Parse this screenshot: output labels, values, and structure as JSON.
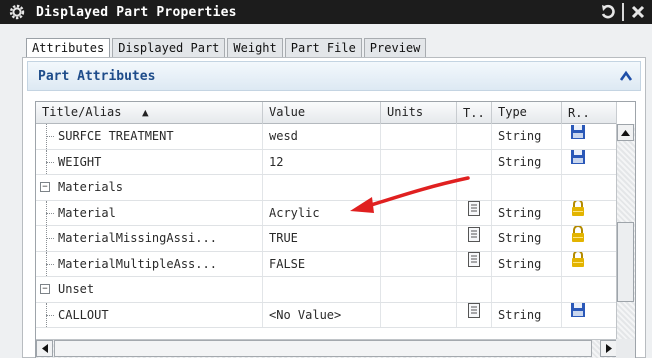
{
  "window": {
    "title": "Displayed Part Properties",
    "icon": "gear-icon"
  },
  "tabs": [
    {
      "label": "Attributes",
      "active": true
    },
    {
      "label": "Displayed Part",
      "active": false
    },
    {
      "label": "Weight",
      "active": false
    },
    {
      "label": "Part File",
      "active": false
    },
    {
      "label": "Preview",
      "active": false
    }
  ],
  "group": {
    "label": "Part Attributes",
    "collapse_icon": "chevron-up-icon"
  },
  "table": {
    "columns": [
      "Title/Alias",
      "Value",
      "Units",
      "T..",
      "Type",
      "R.."
    ],
    "sort_indicator": "▲",
    "rows": [
      {
        "kind": "leaf",
        "title": "SURFCE TREATMENT",
        "value": "wesd",
        "units": "",
        "t_icon": "",
        "type": "String",
        "r_icon": "save-icon"
      },
      {
        "kind": "leaf",
        "title": "WEIGHT",
        "value": "12",
        "units": "",
        "t_icon": "",
        "type": "String",
        "r_icon": "save-icon"
      },
      {
        "kind": "group",
        "title": "Materials",
        "expander": "−"
      },
      {
        "kind": "leaf",
        "title": "Material",
        "value": "Acrylic",
        "units": "",
        "t_icon": "document-icon",
        "type": "String",
        "r_icon": "lock-icon"
      },
      {
        "kind": "leaf",
        "title": "MaterialMissingAssi...",
        "value": "TRUE",
        "units": "",
        "t_icon": "document-icon",
        "type": "String",
        "r_icon": "lock-icon"
      },
      {
        "kind": "leaf",
        "title": "MaterialMultipleAss...",
        "value": "FALSE",
        "units": "",
        "t_icon": "document-icon",
        "type": "String",
        "r_icon": "lock-icon"
      },
      {
        "kind": "group",
        "title": "Unset",
        "expander": "−"
      },
      {
        "kind": "leaf",
        "title": "CALLOUT",
        "value": "<No Value>",
        "units": "",
        "t_icon": "document-icon",
        "type": "String",
        "r_icon": "save-icon"
      }
    ]
  },
  "colors": {
    "titlebar": "#1c1c1c",
    "group_label": "#1e4c8a",
    "arrow": "#e02020",
    "lock": "#e3b400",
    "save": "#2a58b8"
  }
}
